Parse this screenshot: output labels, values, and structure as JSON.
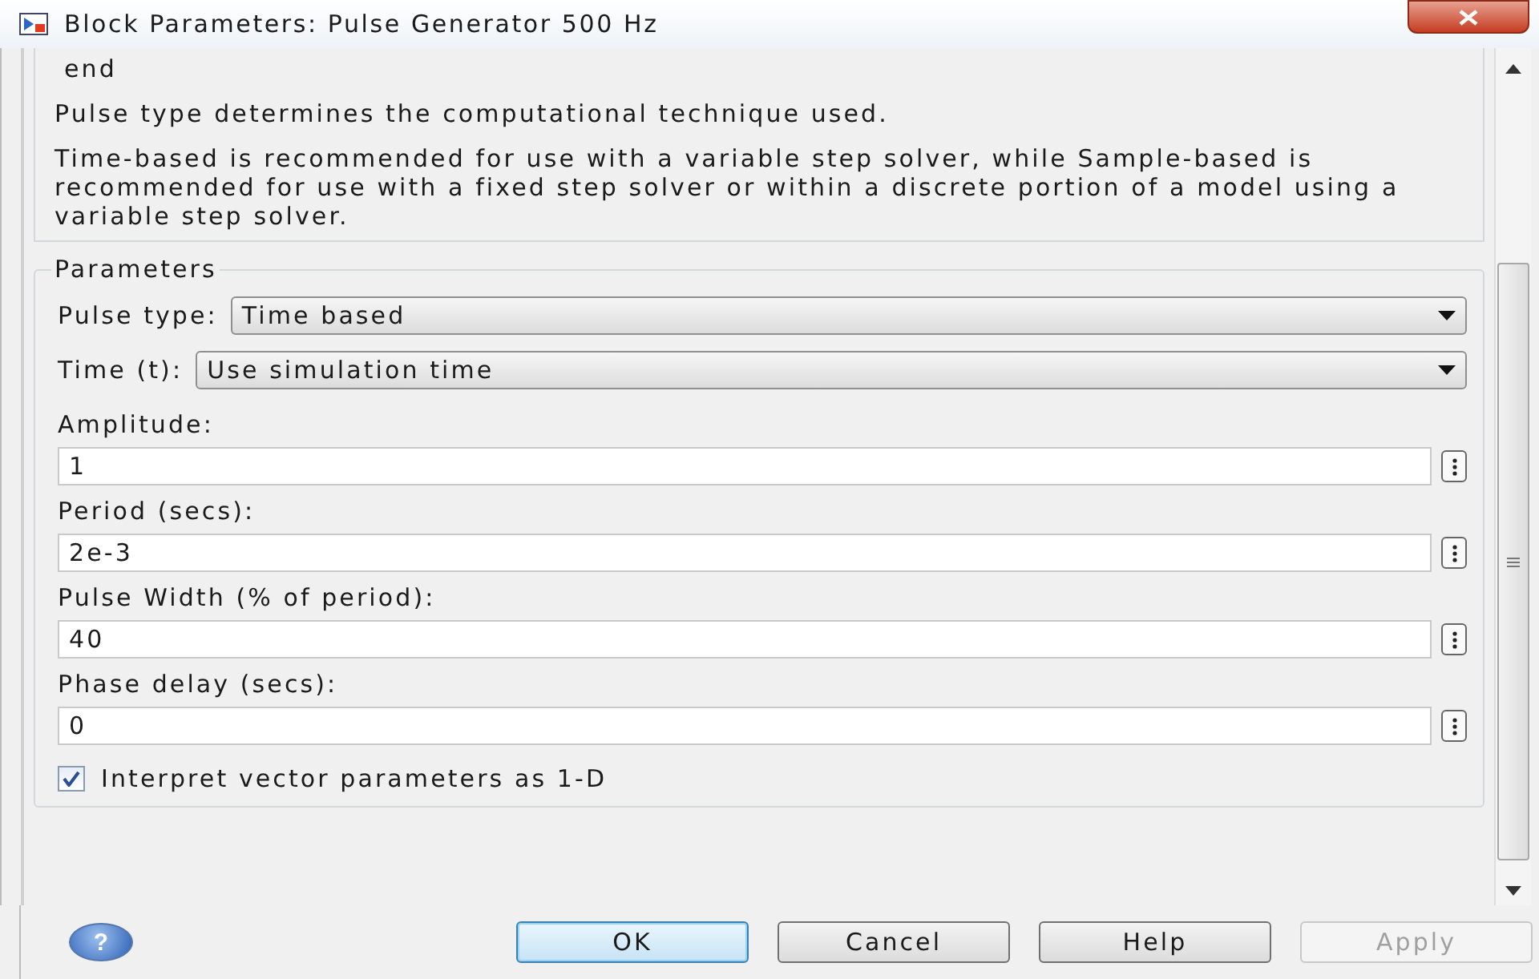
{
  "window": {
    "title": "Block Parameters: Pulse Generator 500 Hz"
  },
  "description": [
    "end",
    "Pulse type determines the computational technique used.",
    "Time-based is recommended for use with a variable step solver, while Sample-based is recommended for use with a fixed step solver or within a discrete portion of a model using a variable step solver."
  ],
  "parameters": {
    "title": "Parameters",
    "rows": [
      {
        "kind": "dropdown",
        "label": "Pulse type:",
        "value": "Time based"
      },
      {
        "kind": "dropdown",
        "label": "Time (t):",
        "value": "Use simulation time"
      },
      {
        "kind": "edit",
        "label": "Amplitude:",
        "value": "1"
      },
      {
        "kind": "edit",
        "label": "Period (secs):",
        "value": "2e-3"
      },
      {
        "kind": "edit",
        "label": "Pulse Width (% of period):",
        "value": "40"
      },
      {
        "kind": "edit",
        "label": "Phase delay (secs):",
        "value": "0"
      },
      {
        "kind": "checkbox",
        "label": "Interpret vector parameters as 1-D",
        "checked": true
      }
    ]
  },
  "help_button": "?",
  "buttons": [
    {
      "label": "OK",
      "default": true,
      "disabled": false
    },
    {
      "label": "Cancel",
      "default": false,
      "disabled": false
    },
    {
      "label": "Help",
      "default": false,
      "disabled": false
    },
    {
      "label": "Apply",
      "default": false,
      "disabled": true
    }
  ]
}
